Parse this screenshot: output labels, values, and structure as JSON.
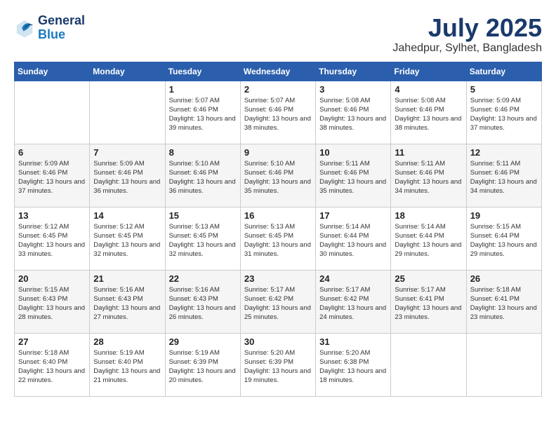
{
  "logo": {
    "line1": "General",
    "line2": "Blue"
  },
  "title": {
    "month_year": "July 2025",
    "location": "Jahedpur, Sylhet, Bangladesh"
  },
  "headers": [
    "Sunday",
    "Monday",
    "Tuesday",
    "Wednesday",
    "Thursday",
    "Friday",
    "Saturday"
  ],
  "weeks": [
    [
      {
        "day": "",
        "info": ""
      },
      {
        "day": "",
        "info": ""
      },
      {
        "day": "1",
        "info": "Sunrise: 5:07 AM\nSunset: 6:46 PM\nDaylight: 13 hours and 39 minutes."
      },
      {
        "day": "2",
        "info": "Sunrise: 5:07 AM\nSunset: 6:46 PM\nDaylight: 13 hours and 38 minutes."
      },
      {
        "day": "3",
        "info": "Sunrise: 5:08 AM\nSunset: 6:46 PM\nDaylight: 13 hours and 38 minutes."
      },
      {
        "day": "4",
        "info": "Sunrise: 5:08 AM\nSunset: 6:46 PM\nDaylight: 13 hours and 38 minutes."
      },
      {
        "day": "5",
        "info": "Sunrise: 5:09 AM\nSunset: 6:46 PM\nDaylight: 13 hours and 37 minutes."
      }
    ],
    [
      {
        "day": "6",
        "info": "Sunrise: 5:09 AM\nSunset: 6:46 PM\nDaylight: 13 hours and 37 minutes."
      },
      {
        "day": "7",
        "info": "Sunrise: 5:09 AM\nSunset: 6:46 PM\nDaylight: 13 hours and 36 minutes."
      },
      {
        "day": "8",
        "info": "Sunrise: 5:10 AM\nSunset: 6:46 PM\nDaylight: 13 hours and 36 minutes."
      },
      {
        "day": "9",
        "info": "Sunrise: 5:10 AM\nSunset: 6:46 PM\nDaylight: 13 hours and 35 minutes."
      },
      {
        "day": "10",
        "info": "Sunrise: 5:11 AM\nSunset: 6:46 PM\nDaylight: 13 hours and 35 minutes."
      },
      {
        "day": "11",
        "info": "Sunrise: 5:11 AM\nSunset: 6:46 PM\nDaylight: 13 hours and 34 minutes."
      },
      {
        "day": "12",
        "info": "Sunrise: 5:11 AM\nSunset: 6:46 PM\nDaylight: 13 hours and 34 minutes."
      }
    ],
    [
      {
        "day": "13",
        "info": "Sunrise: 5:12 AM\nSunset: 6:45 PM\nDaylight: 13 hours and 33 minutes."
      },
      {
        "day": "14",
        "info": "Sunrise: 5:12 AM\nSunset: 6:45 PM\nDaylight: 13 hours and 32 minutes."
      },
      {
        "day": "15",
        "info": "Sunrise: 5:13 AM\nSunset: 6:45 PM\nDaylight: 13 hours and 32 minutes."
      },
      {
        "day": "16",
        "info": "Sunrise: 5:13 AM\nSunset: 6:45 PM\nDaylight: 13 hours and 31 minutes."
      },
      {
        "day": "17",
        "info": "Sunrise: 5:14 AM\nSunset: 6:44 PM\nDaylight: 13 hours and 30 minutes."
      },
      {
        "day": "18",
        "info": "Sunrise: 5:14 AM\nSunset: 6:44 PM\nDaylight: 13 hours and 29 minutes."
      },
      {
        "day": "19",
        "info": "Sunrise: 5:15 AM\nSunset: 6:44 PM\nDaylight: 13 hours and 29 minutes."
      }
    ],
    [
      {
        "day": "20",
        "info": "Sunrise: 5:15 AM\nSunset: 6:43 PM\nDaylight: 13 hours and 28 minutes."
      },
      {
        "day": "21",
        "info": "Sunrise: 5:16 AM\nSunset: 6:43 PM\nDaylight: 13 hours and 27 minutes."
      },
      {
        "day": "22",
        "info": "Sunrise: 5:16 AM\nSunset: 6:43 PM\nDaylight: 13 hours and 26 minutes."
      },
      {
        "day": "23",
        "info": "Sunrise: 5:17 AM\nSunset: 6:42 PM\nDaylight: 13 hours and 25 minutes."
      },
      {
        "day": "24",
        "info": "Sunrise: 5:17 AM\nSunset: 6:42 PM\nDaylight: 13 hours and 24 minutes."
      },
      {
        "day": "25",
        "info": "Sunrise: 5:17 AM\nSunset: 6:41 PM\nDaylight: 13 hours and 23 minutes."
      },
      {
        "day": "26",
        "info": "Sunrise: 5:18 AM\nSunset: 6:41 PM\nDaylight: 13 hours and 23 minutes."
      }
    ],
    [
      {
        "day": "27",
        "info": "Sunrise: 5:18 AM\nSunset: 6:40 PM\nDaylight: 13 hours and 22 minutes."
      },
      {
        "day": "28",
        "info": "Sunrise: 5:19 AM\nSunset: 6:40 PM\nDaylight: 13 hours and 21 minutes."
      },
      {
        "day": "29",
        "info": "Sunrise: 5:19 AM\nSunset: 6:39 PM\nDaylight: 13 hours and 20 minutes."
      },
      {
        "day": "30",
        "info": "Sunrise: 5:20 AM\nSunset: 6:39 PM\nDaylight: 13 hours and 19 minutes."
      },
      {
        "day": "31",
        "info": "Sunrise: 5:20 AM\nSunset: 6:38 PM\nDaylight: 13 hours and 18 minutes."
      },
      {
        "day": "",
        "info": ""
      },
      {
        "day": "",
        "info": ""
      }
    ]
  ]
}
